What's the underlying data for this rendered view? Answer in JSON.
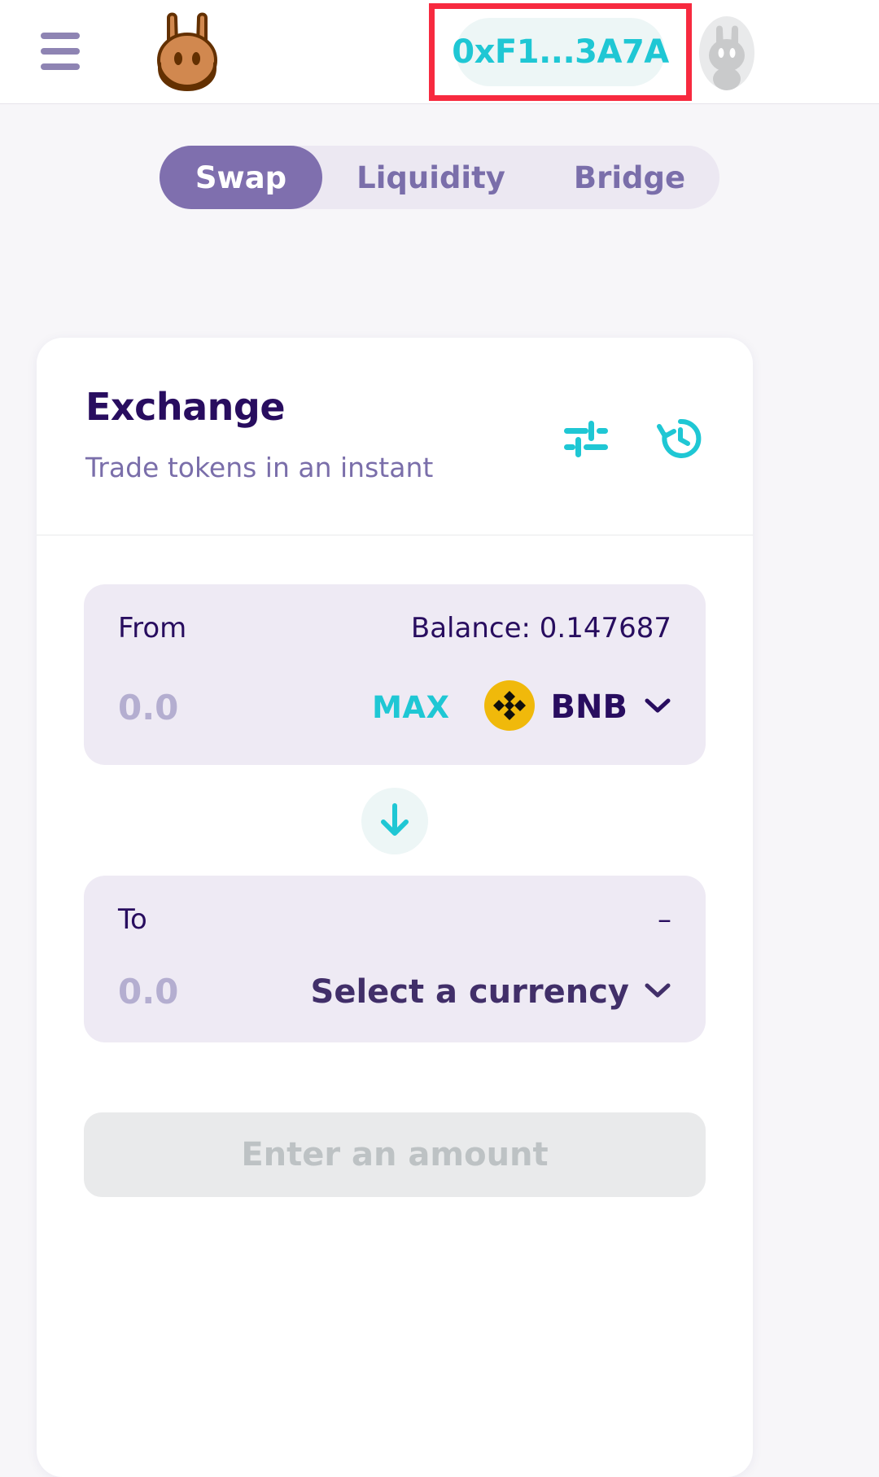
{
  "header": {
    "menu_icon": "hamburger-menu-icon",
    "logo_icon": "pancakeswap-bunny-logo",
    "wallet_address": "0xF1...3A7A",
    "avatar_icon": "user-bunny-avatar",
    "highlight_color": "#f72a3f",
    "accent_color": "#1fc7d4"
  },
  "tabs": [
    {
      "label": "Swap",
      "active": true
    },
    {
      "label": "Liquidity",
      "active": false
    },
    {
      "label": "Bridge",
      "active": false
    }
  ],
  "exchange": {
    "title": "Exchange",
    "subtitle": "Trade tokens in an instant",
    "settings_icon": "tune-sliders-icon",
    "history_icon": "history-clock-icon"
  },
  "from_panel": {
    "label": "From",
    "balance": "Balance: 0.147687",
    "amount": "0.0",
    "amount_placeholder": "0.0",
    "max_label": "MAX",
    "token": "BNB",
    "token_icon": "bnb-token-icon",
    "chevron_icon": "chevron-down-icon"
  },
  "swap_toggle": {
    "icon": "arrow-down-icon"
  },
  "to_panel": {
    "label": "To",
    "balance": "–",
    "amount": "0.0",
    "amount_placeholder": "0.0",
    "currency_label": "Select a currency",
    "chevron_icon": "chevron-down-icon"
  },
  "cta": {
    "label": "Enter an amount",
    "disabled": true
  },
  "colors": {
    "primary_text": "#280d5f",
    "secondary_text": "#7a6eaa",
    "cyan": "#1fc7d4",
    "panel_bg": "#eeeaf4",
    "page_bg": "#f7f6f9",
    "tab_active_bg": "#7f6fae",
    "bnb_yellow": "#f0b90b"
  }
}
